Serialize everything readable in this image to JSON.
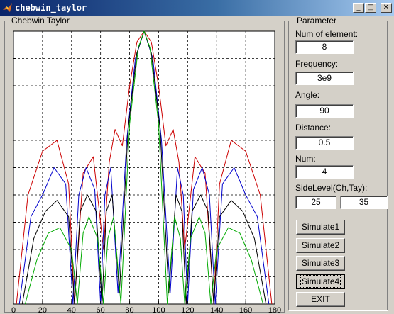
{
  "window": {
    "title": "chebwin_taylor",
    "app_icon": "matlab-icon"
  },
  "plot_panel": {
    "label": "Chebwin Taylor"
  },
  "params": {
    "label": "Parameter",
    "num_element": {
      "label": "Num of element:",
      "value": "8"
    },
    "frequency": {
      "label": "Frequency:",
      "value": "3e9"
    },
    "angle": {
      "label": "Angle:",
      "value": "90"
    },
    "distance": {
      "label": "Distance:",
      "value": "0.5"
    },
    "num": {
      "label": "Num:",
      "value": "4"
    },
    "sidelevel": {
      "label": "SideLevel(Ch,Tay):",
      "cheb": "25",
      "taylor": "35"
    }
  },
  "buttons": {
    "sim1": "Simulate1",
    "sim2": "Simulate2",
    "sim3": "Simulate3",
    "sim4": "Simulate4",
    "exit": "EXIT"
  },
  "chart_data": {
    "type": "line",
    "title": "",
    "xlabel": "",
    "ylabel": "",
    "xlim": [
      0,
      180
    ],
    "ylim": [
      -50,
      0
    ],
    "xticks": [
      "0",
      "20",
      "40",
      "60",
      "80",
      "100",
      "120",
      "140",
      "160",
      "180"
    ],
    "grid": true,
    "series": [
      {
        "color": "#cc0000",
        "x": [
          2,
          10,
          20,
          30,
          38,
          42,
          48,
          55,
          62,
          66,
          70,
          75,
          80,
          85,
          90,
          95,
          100,
          105,
          110,
          114,
          118,
          125,
          132,
          138,
          142,
          150,
          160,
          170,
          178
        ],
        "y": [
          -50,
          -30,
          -22,
          -20,
          -28,
          -50,
          -26,
          -23,
          -40,
          -24,
          -18,
          -21,
          -10,
          -2,
          0,
          -2,
          -10,
          -21,
          -18,
          -24,
          -40,
          -23,
          -26,
          -50,
          -28,
          -20,
          -22,
          -30,
          -50
        ]
      },
      {
        "color": "#0000cc",
        "x": [
          4,
          12,
          20,
          28,
          36,
          41,
          45,
          50,
          56,
          60,
          63,
          67,
          72,
          78,
          84,
          90,
          96,
          102,
          108,
          113,
          117,
          120,
          124,
          130,
          135,
          139,
          144,
          152,
          160,
          168,
          176
        ],
        "y": [
          -50,
          -34,
          -30,
          -25,
          -28,
          -50,
          -30,
          -25,
          -29,
          -50,
          -30,
          -25,
          -48,
          -20,
          -5,
          0,
          -5,
          -20,
          -48,
          -25,
          -30,
          -50,
          -29,
          -25,
          -30,
          -50,
          -28,
          -25,
          -30,
          -34,
          -50
        ]
      },
      {
        "color": "#000000",
        "x": [
          6,
          14,
          22,
          30,
          38,
          42,
          46,
          51,
          57,
          61,
          64,
          68,
          73,
          79,
          85,
          90,
          95,
          101,
          107,
          112,
          116,
          119,
          123,
          129,
          134,
          138,
          142,
          150,
          158,
          166,
          174
        ],
        "y": [
          -50,
          -38,
          -33,
          -31,
          -34,
          -50,
          -33,
          -30,
          -33,
          -50,
          -33,
          -30,
          -48,
          -18,
          -4,
          0,
          -4,
          -18,
          -48,
          -30,
          -33,
          -50,
          -33,
          -30,
          -33,
          -50,
          -34,
          -31,
          -33,
          -38,
          -50
        ]
      },
      {
        "color": "#00aa00",
        "x": [
          8,
          16,
          24,
          32,
          40,
          44,
          48,
          52,
          58,
          62,
          65,
          69,
          74,
          80,
          86,
          90,
          94,
          100,
          106,
          111,
          115,
          118,
          122,
          128,
          132,
          136,
          140,
          148,
          156,
          164,
          172
        ],
        "y": [
          -50,
          -42,
          -37,
          -36,
          -40,
          -50,
          -37,
          -34,
          -38,
          -50,
          -38,
          -34,
          -50,
          -17,
          -3,
          0,
          -3,
          -17,
          -50,
          -34,
          -38,
          -50,
          -38,
          -34,
          -37,
          -50,
          -40,
          -36,
          -37,
          -42,
          -50
        ]
      }
    ]
  }
}
